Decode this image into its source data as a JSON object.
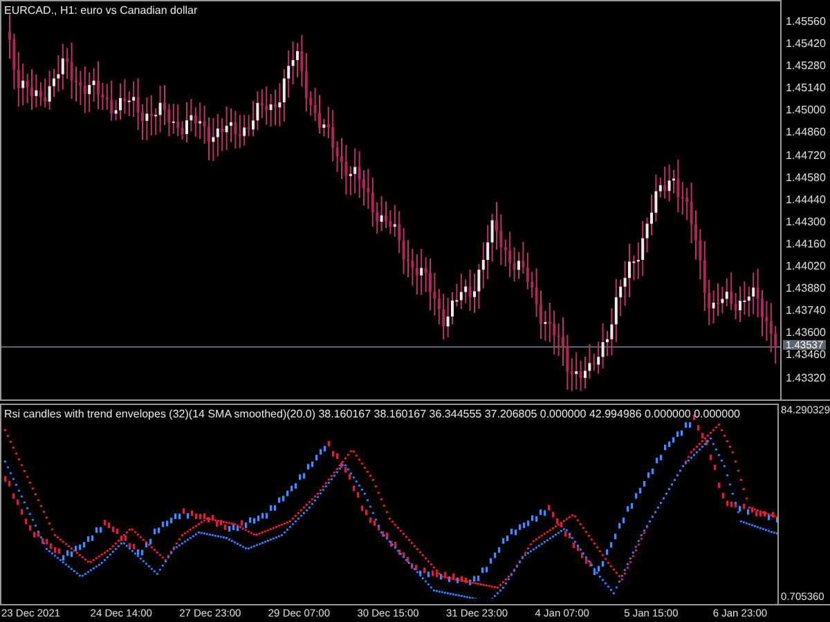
{
  "main_pane": {
    "title": "EURCAD., H1:  euro vs Canadian dollar",
    "price_axis": [
      "1.45560",
      "1.45420",
      "1.45280",
      "1.45140",
      "1.45000",
      "1.44860",
      "1.44720",
      "1.44580",
      "1.44440",
      "1.44300",
      "1.44160",
      "1.44020",
      "1.43880",
      "1.43740",
      "1.43600",
      "1.43460",
      "1.43320"
    ],
    "current_price": "1.43537"
  },
  "indicator_pane": {
    "title": "Rsi candles with trend envelopes (32)(14 SMA smoothed)(20.0) 38.160167 38.160167 36.344555 37.206805 0.000000 42.994986 0.000000 0.000000",
    "axis": [
      "84.290329",
      "0.705360"
    ]
  },
  "time_axis": [
    "23 Dec 2021",
    "24 Dec 14:00",
    "27 Dec 23:00",
    "29 Dec 07:00",
    "30 Dec 15:00",
    "31 Dec 23:00",
    "4 Jan 07:00",
    "5 Jan 15:00",
    "6 Jan 23:00"
  ]
}
